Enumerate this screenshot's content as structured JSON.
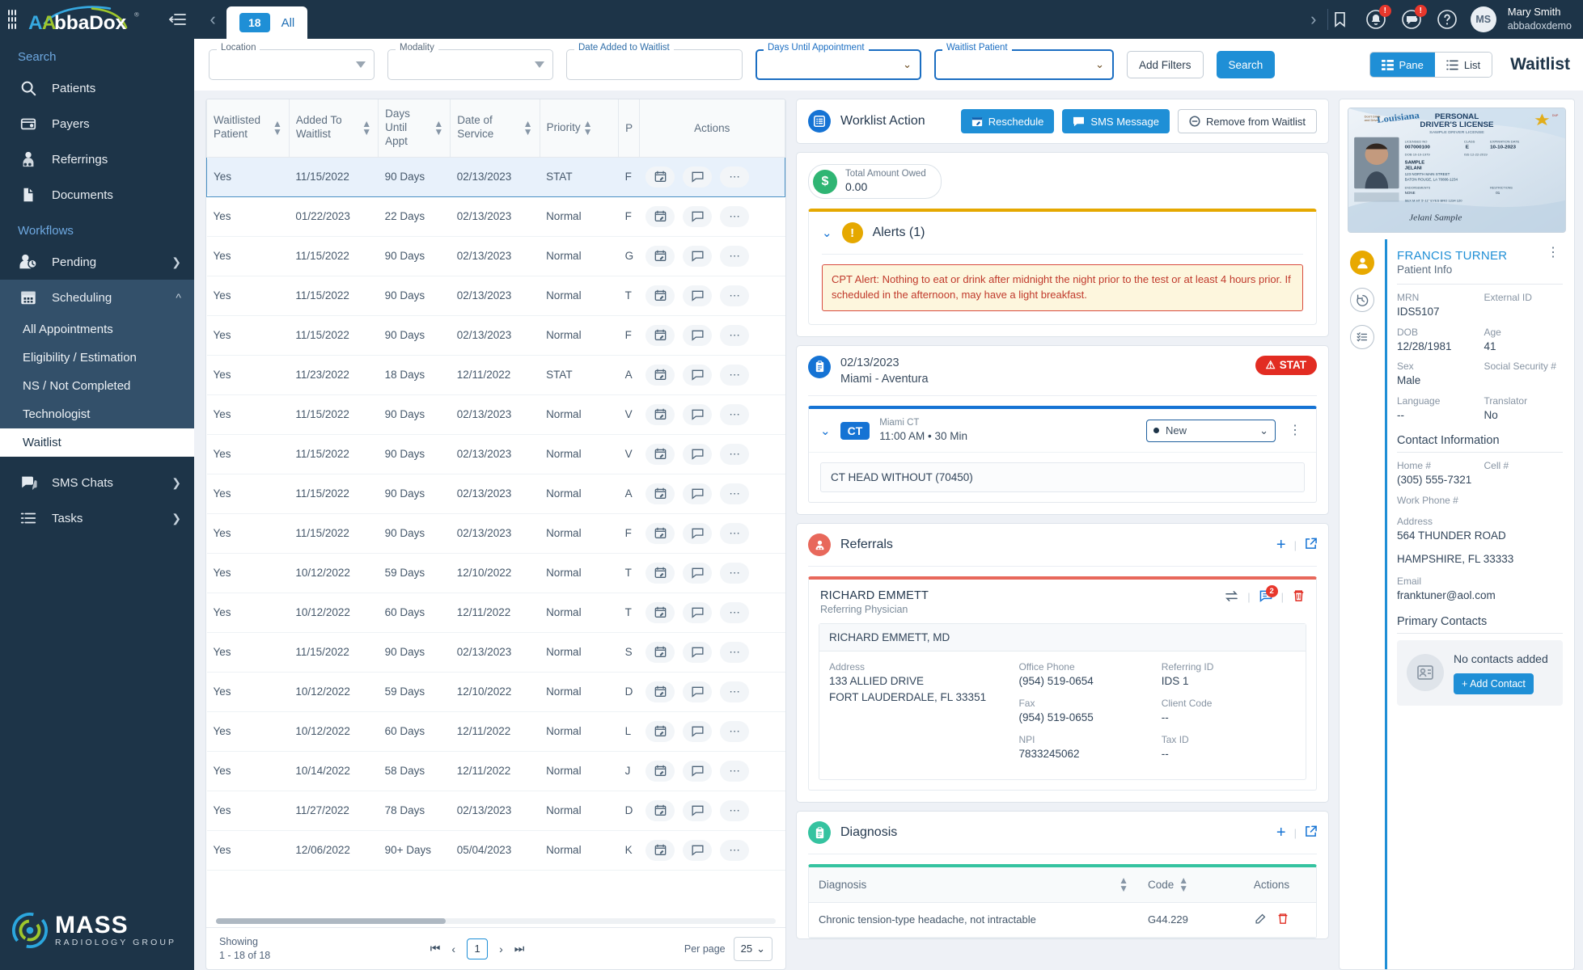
{
  "brand": {
    "name": "AbbaDox",
    "footer_logo": "MASS",
    "footer_sub": "RADIOLOGY GROUP"
  },
  "topbar": {
    "tab_count": "18",
    "tab_all": "All",
    "user_name": "Mary Smith",
    "user_org": "abbadoxdemo",
    "avatar_initials": "MS",
    "bell_badge": "!",
    "sms_badge": "!"
  },
  "sidebar": {
    "search_label": "Search",
    "workflows_label": "Workflows",
    "items": [
      {
        "label": "Patients",
        "icon": "search-icon"
      },
      {
        "label": "Payers",
        "icon": "wallet-icon"
      },
      {
        "label": "Referrings",
        "icon": "doctor-icon"
      },
      {
        "label": "Documents",
        "icon": "document-icon"
      }
    ],
    "workflows": [
      {
        "label": "Pending",
        "icon": "person-clock-icon"
      },
      {
        "label": "Scheduling",
        "icon": "calendar-icon"
      }
    ],
    "scheduling_subitems": [
      {
        "label": "All Appointments",
        "active": false
      },
      {
        "label": "Eligibility / Estimation",
        "active": false
      },
      {
        "label": "NS / Not Completed",
        "active": false
      },
      {
        "label": "Technologist",
        "active": false
      },
      {
        "label": "Waitlist",
        "active": true
      }
    ],
    "bottom_items": [
      {
        "label": "SMS Chats",
        "icon": "chat-icon"
      },
      {
        "label": "Tasks",
        "icon": "list-icon"
      }
    ]
  },
  "filters": {
    "fields": [
      {
        "label": "Location",
        "value": "",
        "kind": "select",
        "focused": false
      },
      {
        "label": "Modality",
        "value": "",
        "kind": "select",
        "focused": false
      },
      {
        "label": "Date Added to Waitlist",
        "value": "",
        "kind": "text",
        "focused": false
      },
      {
        "label": "Days Until Appointment",
        "value": "",
        "kind": "select",
        "focused": true
      },
      {
        "label": "Waitlist Patient",
        "value": "",
        "kind": "select",
        "focused": true
      }
    ],
    "add_filters_label": "Add Filters",
    "search_label": "Search",
    "view_pane_label": "Pane",
    "view_list_label": "List",
    "page_title": "Waitlist"
  },
  "grid": {
    "columns": [
      "Waitlisted Patient",
      "Added To Waitlist",
      "Days Until Appt",
      "Date of Service",
      "Priority",
      "P",
      "Actions"
    ],
    "rows": [
      {
        "waitlisted": "Yes",
        "added": "11/15/2022",
        "days": "90 Days",
        "dos": "02/13/2023",
        "priority": "STAT",
        "patient": "F",
        "selected": true
      },
      {
        "waitlisted": "Yes",
        "added": "01/22/2023",
        "days": "22 Days",
        "dos": "02/13/2023",
        "priority": "Normal",
        "patient": "F",
        "selected": false
      },
      {
        "waitlisted": "Yes",
        "added": "11/15/2022",
        "days": "90 Days",
        "dos": "02/13/2023",
        "priority": "Normal",
        "patient": "G",
        "selected": false
      },
      {
        "waitlisted": "Yes",
        "added": "11/15/2022",
        "days": "90 Days",
        "dos": "02/13/2023",
        "priority": "Normal",
        "patient": "T",
        "selected": false
      },
      {
        "waitlisted": "Yes",
        "added": "11/15/2022",
        "days": "90 Days",
        "dos": "02/13/2023",
        "priority": "Normal",
        "patient": "F",
        "selected": false
      },
      {
        "waitlisted": "Yes",
        "added": "11/23/2022",
        "days": "18 Days",
        "dos": "12/11/2022",
        "priority": "STAT",
        "patient": "A",
        "selected": false
      },
      {
        "waitlisted": "Yes",
        "added": "11/15/2022",
        "days": "90 Days",
        "dos": "02/13/2023",
        "priority": "Normal",
        "patient": "V",
        "selected": false
      },
      {
        "waitlisted": "Yes",
        "added": "11/15/2022",
        "days": "90 Days",
        "dos": "02/13/2023",
        "priority": "Normal",
        "patient": "V",
        "selected": false
      },
      {
        "waitlisted": "Yes",
        "added": "11/15/2022",
        "days": "90 Days",
        "dos": "02/13/2023",
        "priority": "Normal",
        "patient": "A",
        "selected": false
      },
      {
        "waitlisted": "Yes",
        "added": "11/15/2022",
        "days": "90 Days",
        "dos": "02/13/2023",
        "priority": "Normal",
        "patient": "F",
        "selected": false
      },
      {
        "waitlisted": "Yes",
        "added": "10/12/2022",
        "days": "59 Days",
        "dos": "12/10/2022",
        "priority": "Normal",
        "patient": "T",
        "selected": false
      },
      {
        "waitlisted": "Yes",
        "added": "10/12/2022",
        "days": "60 Days",
        "dos": "12/11/2022",
        "priority": "Normal",
        "patient": "T",
        "selected": false
      },
      {
        "waitlisted": "Yes",
        "added": "11/15/2022",
        "days": "90 Days",
        "dos": "02/13/2023",
        "priority": "Normal",
        "patient": "S",
        "selected": false
      },
      {
        "waitlisted": "Yes",
        "added": "10/12/2022",
        "days": "59 Days",
        "dos": "12/10/2022",
        "priority": "Normal",
        "patient": "D",
        "selected": false
      },
      {
        "waitlisted": "Yes",
        "added": "10/12/2022",
        "days": "60 Days",
        "dos": "12/11/2022",
        "priority": "Normal",
        "patient": "L",
        "selected": false
      },
      {
        "waitlisted": "Yes",
        "added": "10/14/2022",
        "days": "58 Days",
        "dos": "12/11/2022",
        "priority": "Normal",
        "patient": "J",
        "selected": false
      },
      {
        "waitlisted": "Yes",
        "added": "11/27/2022",
        "days": "78 Days",
        "dos": "02/13/2023",
        "priority": "Normal",
        "patient": "D",
        "selected": false
      },
      {
        "waitlisted": "Yes",
        "added": "12/06/2022",
        "days": "90+ Days",
        "dos": "05/04/2023",
        "priority": "Normal",
        "patient": "K",
        "selected": false
      }
    ],
    "showing_label": "Showing",
    "showing_range": "1 - 18 of 18",
    "current_page": "1",
    "per_page_label": "Per page",
    "per_page_value": "25"
  },
  "worklist": {
    "title": "Worklist Action",
    "reschedule": "Reschedule",
    "sms_message": "SMS Message",
    "remove": "Remove from Waitlist",
    "owed_label": "Total Amount Owed",
    "owed_value": "0.00",
    "alerts_title": "Alerts (1)",
    "alert_text": "CPT Alert: Nothing to eat or drink after midnight the night prior to the test or at least 4 hours prior. If scheduled in the afternoon, may have a light breakfast."
  },
  "appointment": {
    "date": "02/13/2023",
    "location": "Miami - Aventura",
    "stat_badge": "STAT",
    "modality": "CT",
    "resource": "Miami CT",
    "time": "11:00 AM  •  30 Min",
    "status": "New",
    "procedure": "CT HEAD WITHOUT (70450)"
  },
  "referrals": {
    "title": "Referrals",
    "name": "RICHARD EMMETT",
    "role": "Referring Physician",
    "comment_count": "2",
    "card_name": "RICHARD EMMETT, MD",
    "address_label": "Address",
    "address_line1": "133 ALLIED DRIVE",
    "address_line2": "FORT LAUDERDALE, FL 33351",
    "office_phone_label": "Office Phone",
    "office_phone": "(954) 519-0654",
    "fax_label": "Fax",
    "fax": "(954) 519-0655",
    "npi_label": "NPI",
    "npi": "7833245062",
    "referring_id_label": "Referring ID",
    "referring_id": "IDS 1",
    "client_code_label": "Client Code",
    "client_code": "--",
    "tax_id_label": "Tax ID",
    "tax_id": "--"
  },
  "diagnosis": {
    "title": "Diagnosis",
    "columns": [
      "Diagnosis",
      "Code",
      "Actions"
    ],
    "rows": [
      {
        "name": "Chronic tension-type headache, not intractable",
        "code": "G44.229"
      }
    ]
  },
  "patient": {
    "license_state": "Louisiana",
    "license_title": "PERSONAL DRIVER'S LICENSE",
    "license_sub": "SAMPLE DRIVER LICENSE",
    "license_dl_label": "LICENSED NO",
    "license_dl": "007000100",
    "license_class_label": "CLASS",
    "license_class": "E",
    "license_exp_label": "EXPIRATION DATE",
    "license_exp": "10-10-2023",
    "license_dob_label": "DOB",
    "license_dob": "10-10-1979",
    "license_issue": "ISS 12-22-2019",
    "license_last": "SAMPLE",
    "license_first": "JELANI",
    "license_addr1": "123 NORTH MAIN STREET",
    "license_addr2": "BATON ROUGE, LA 70806-1234",
    "license_end_label": "ENDORSEMENTS",
    "license_end": "NONE",
    "license_restr_label": "RESTRICTIONS",
    "license_restr": "01",
    "license_sex": "SEX  M",
    "license_ht": "HT 5'-11\"",
    "license_eyes": "EYES BRO",
    "license_hair": "1234",
    "license_wt": "120",
    "license_warn": "Don't Drink and Drive",
    "license_signature": "Jelani Sample",
    "name": "FRANCIS TURNER",
    "subtitle": "Patient Info",
    "fields": [
      {
        "label": "MRN",
        "value": "IDS5107"
      },
      {
        "label": "External ID",
        "value": ""
      },
      {
        "label": "DOB",
        "value": "12/28/1981"
      },
      {
        "label": "Age",
        "value": "41"
      },
      {
        "label": "Sex",
        "value": "Male"
      },
      {
        "label": "Social Security #",
        "value": ""
      },
      {
        "label": "Language",
        "value": "--"
      },
      {
        "label": "Translator",
        "value": "No"
      }
    ],
    "contact_heading": "Contact Information",
    "contact_fields": [
      {
        "label": "Home #",
        "value": "(305) 555-7321"
      },
      {
        "label": "Cell #",
        "value": ""
      },
      {
        "label": "Work Phone #",
        "value": ""
      }
    ],
    "address_label": "Address",
    "address_line1": "564 THUNDER ROAD",
    "address_line2": "HAMPSHIRE, FL 33333",
    "email_label": "Email",
    "email": "franktuner@aol.com",
    "primary_contacts_heading": "Primary Contacts",
    "no_contacts": "No contacts added",
    "add_contact": "+ Add Contact"
  },
  "colors": {
    "brand_dark": "#1d3448",
    "accent_blue": "#1f8fd6",
    "alert_red": "#c0392b",
    "warn_yellow": "#e5a800",
    "green": "#2fb573",
    "teal": "#35c3a0",
    "coral": "#e8685b"
  }
}
